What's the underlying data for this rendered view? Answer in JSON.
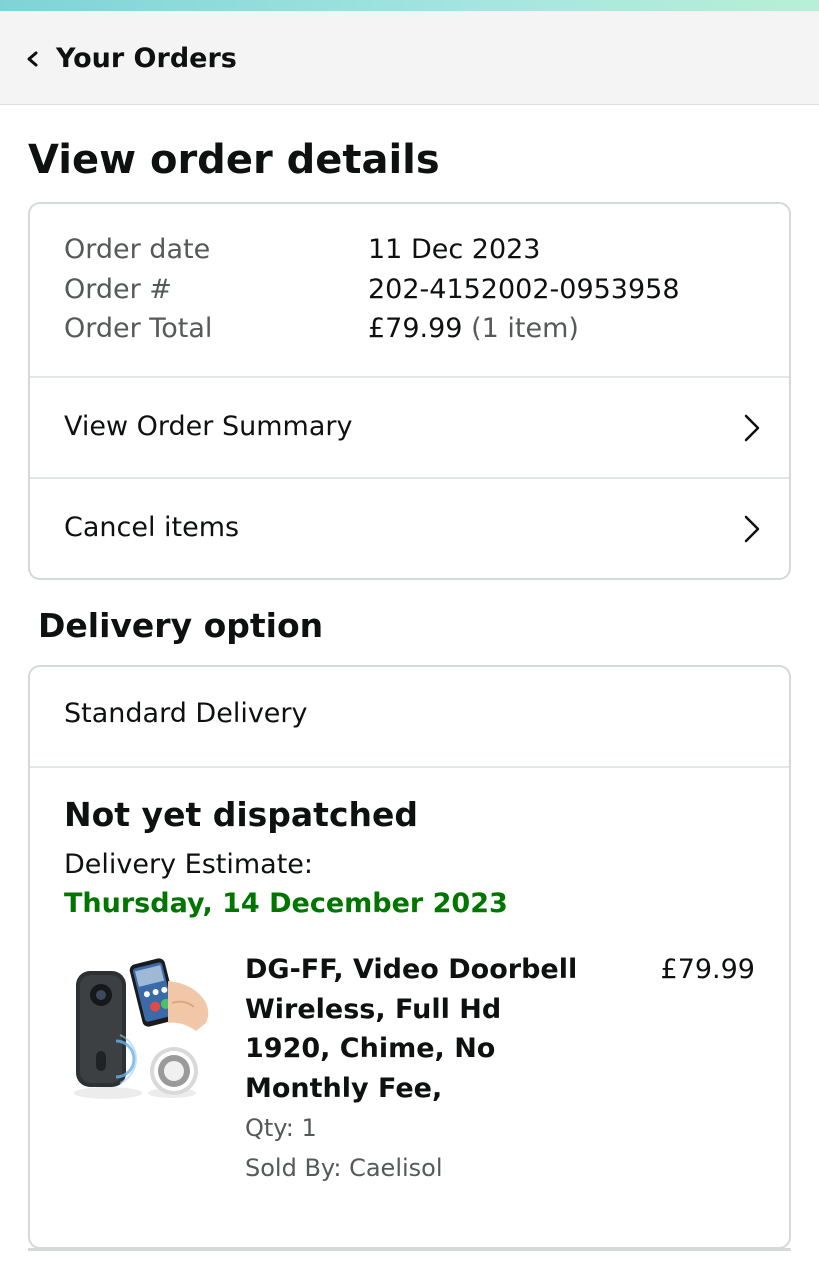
{
  "header": {
    "back_label": "Your Orders",
    "back_icon": "chevron-left-icon"
  },
  "page": {
    "title": "View order details"
  },
  "order": {
    "date_label": "Order date",
    "date_value": "11 Dec 2023",
    "number_label": "Order #",
    "number_value": "202-4152002-0953958",
    "total_label": "Order Total",
    "total_value": "£79.99",
    "total_items": "(1 item)"
  },
  "links": {
    "summary_label": "View Order Summary",
    "cancel_label": "Cancel items",
    "icon": "chevron-right-icon"
  },
  "delivery": {
    "section_title": "Delivery option",
    "method": "Standard Delivery",
    "status": "Not yet dispatched",
    "estimate_label": "Delivery Estimate:",
    "estimate_date": "Thursday, 14 December 2023",
    "estimate_color": "#007600"
  },
  "product": {
    "title": "DG-FF, Video Doorbell Wireless, Full Hd 1920, Chime, No Monthly Fee,",
    "price": "£79.99",
    "qty": "Qty: 1",
    "seller": "Sold By: Caelisol",
    "image_icon": "video-doorbell-image"
  }
}
